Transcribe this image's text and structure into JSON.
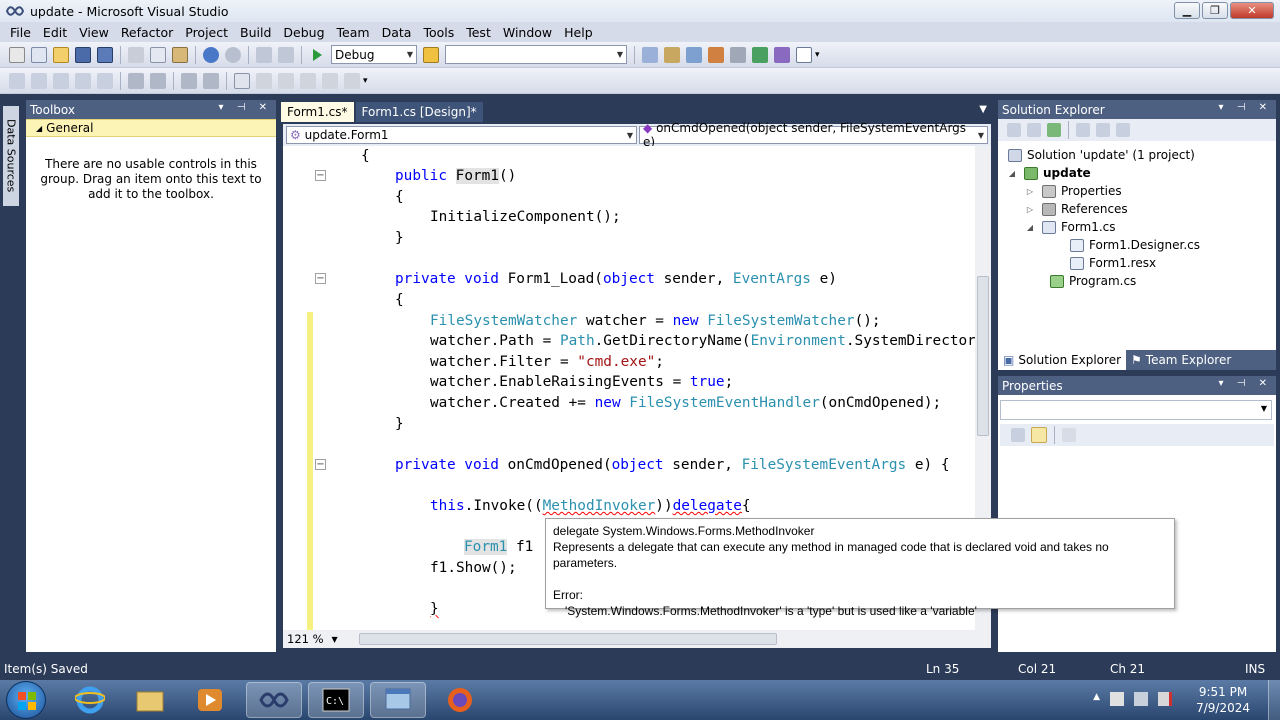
{
  "window": {
    "title": "update - Microsoft Visual Studio"
  },
  "menu": [
    "File",
    "Edit",
    "View",
    "Refactor",
    "Project",
    "Build",
    "Debug",
    "Team",
    "Data",
    "Tools",
    "Test",
    "Window",
    "Help"
  ],
  "toolbar": {
    "config": "Debug",
    "platform": ""
  },
  "toolbox": {
    "title": "Toolbox",
    "group": "General",
    "message": "There are no usable controls in this group. Drag an item onto this text to add it to the toolbox."
  },
  "side_tab": "Data Sources",
  "editor": {
    "tabs": [
      "Form1.cs*",
      "Form1.cs [Design]*"
    ],
    "nav_left": "update.Form1",
    "nav_right": "onCmdOpened(object sender, FileSystemEventArgs e)",
    "zoom": "121 %",
    "code": {
      "l1": "{",
      "l2a": "public ",
      "l2b": "Form1",
      "l2c": "()",
      "l3": "{",
      "l4": "InitializeComponent();",
      "l5": "}",
      "l7a": "private void ",
      "l7b": "Form1_Load(",
      "l7c": "object",
      "l7d": " sender, ",
      "l7e": "EventArgs",
      "l7f": " e)",
      "l8": "{",
      "l9a": "FileSystemWatcher",
      "l9b": " watcher = ",
      "l9c": "new ",
      "l9d": "FileSystemWatcher",
      "l9e": "();",
      "l10a": "watcher.Path = ",
      "l10b": "Path",
      "l10c": ".GetDirectoryName(",
      "l10d": "Environment",
      "l10e": ".SystemDirector",
      "l11a": "watcher.Filter = ",
      "l11b": "\"cmd.exe\"",
      "l11c": ";",
      "l12a": "watcher.EnableRaisingEvents = ",
      "l12b": "true",
      "l12c": ";",
      "l13a": "watcher.Created += ",
      "l13b": "new ",
      "l13c": "FileSystemEventHandler",
      "l13d": "(onCmdOpened);",
      "l14": "}",
      "l16a": "private void ",
      "l16b": "onCmdOpened(",
      "l16c": "object",
      "l16d": " sender, ",
      "l16e": "FileSystemEventArgs",
      "l16f": " e) {",
      "l18a": "this",
      "l18b": ".Invoke((",
      "l18c": "MethodInvoker",
      "l18d": "))",
      "l18e": "delegate",
      "l18f": "{",
      "l20a": "Form1",
      "l20b": " f1",
      "l21": "f1.Show();",
      "l23": "}"
    }
  },
  "tooltip": {
    "line1": "delegate System.Windows.Forms.MethodInvoker",
    "line2": "Represents a delegate that can execute any method in managed code that is declared void and takes no parameters.",
    "error_label": "Error:",
    "error_detail": "'System.Windows.Forms.MethodInvoker' is a 'type' but is used like a 'variable'"
  },
  "solution_explorer": {
    "title": "Solution Explorer",
    "items": [
      "Solution 'update' (1 project)",
      "update",
      "Properties",
      "References",
      "Form1.cs",
      "Form1.Designer.cs",
      "Form1.resx",
      "Program.cs"
    ],
    "tabs": [
      "Solution Explorer",
      "Team Explorer"
    ]
  },
  "properties": {
    "title": "Properties"
  },
  "status": {
    "message": "Item(s) Saved",
    "ln": "Ln 35",
    "col": "Col 21",
    "ch": "Ch 21",
    "mode": "INS"
  },
  "taskbar": {
    "time": "9:51 PM",
    "date": "7/9/2024"
  },
  "colors": {
    "keyword": "#0000ff",
    "type": "#2b91af",
    "string": "#a31515",
    "chrome": "#2b3b58",
    "panel_header": "#4d6082"
  }
}
